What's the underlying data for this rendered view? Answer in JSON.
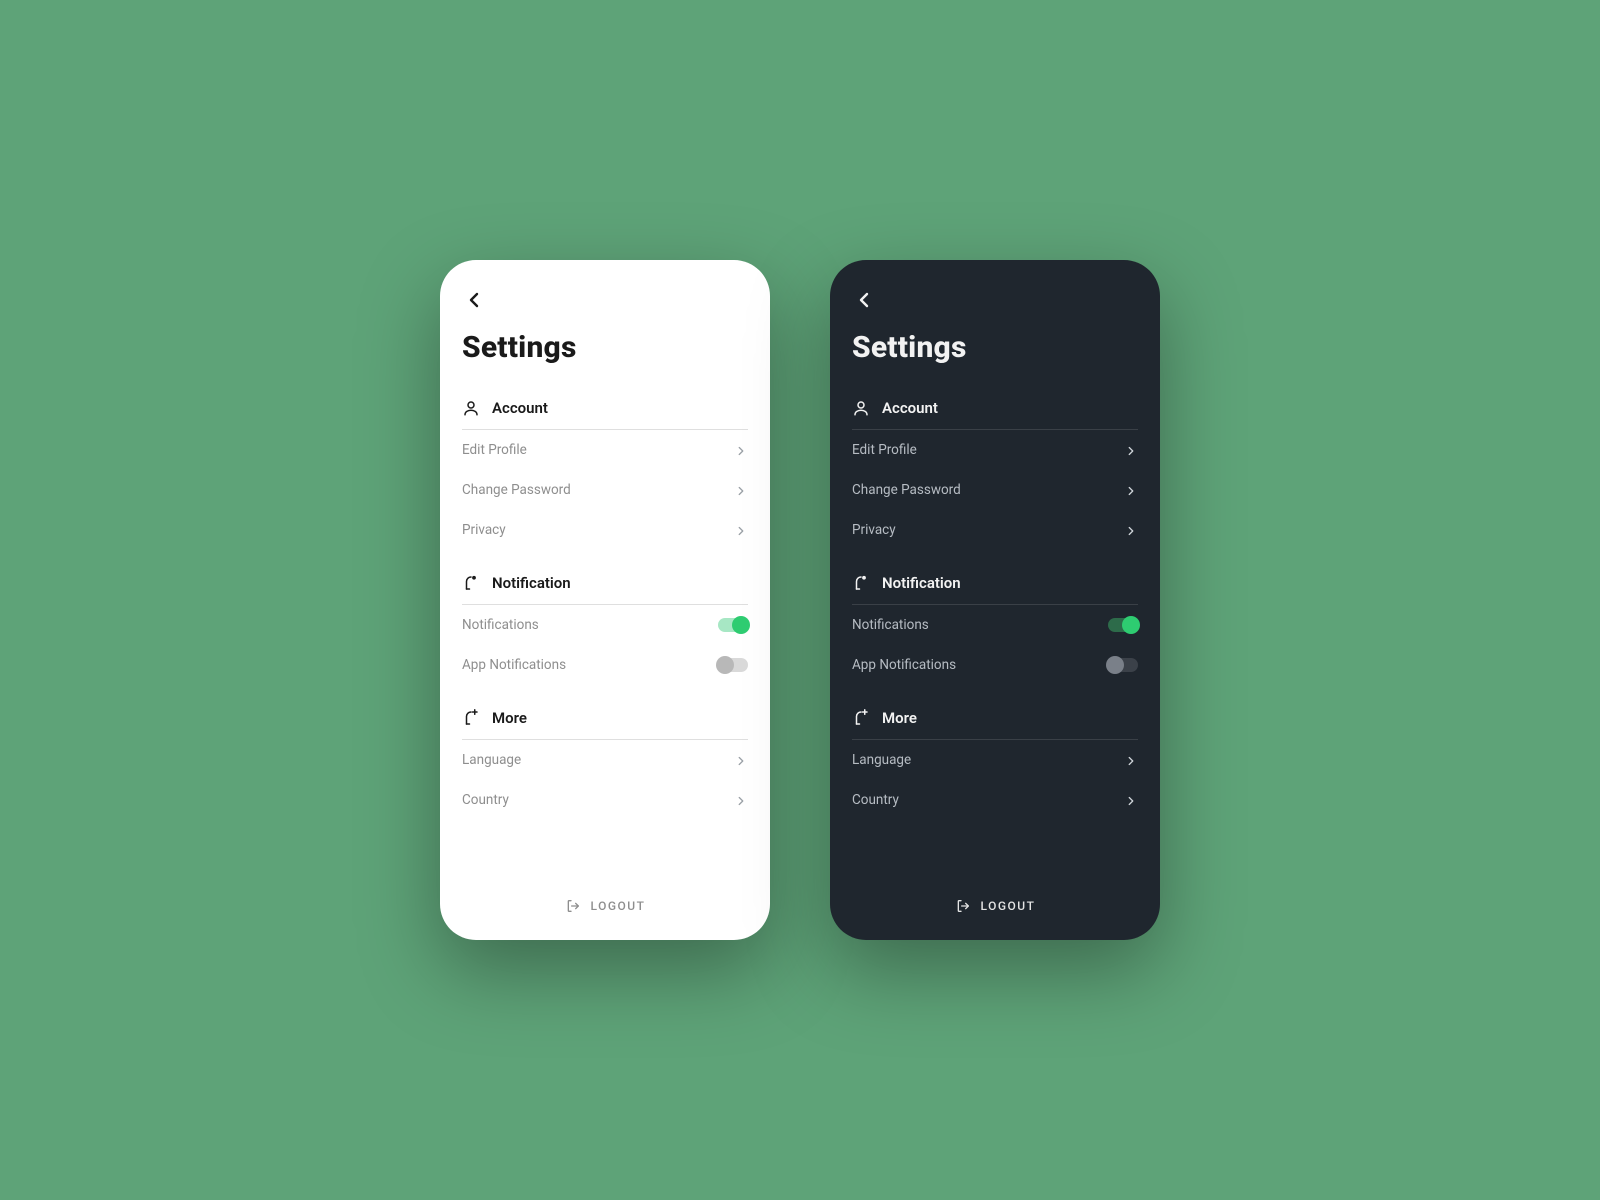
{
  "colors": {
    "background": "#5ea378",
    "light_bg": "#ffffff",
    "dark_bg": "#1f262e",
    "accent": "#2ecc71"
  },
  "page_title": "Settings",
  "sections": {
    "account": {
      "title": "Account",
      "items": [
        {
          "label": "Edit Profile"
        },
        {
          "label": "Change Password"
        },
        {
          "label": "Privacy"
        }
      ]
    },
    "notification": {
      "title": "Notification",
      "items": [
        {
          "label": "Notifications",
          "toggle": true
        },
        {
          "label": "App Notifications",
          "toggle": false
        }
      ]
    },
    "more": {
      "title": "More",
      "items": [
        {
          "label": "Language"
        },
        {
          "label": "Country"
        }
      ]
    }
  },
  "logout_label": "LOGOUT"
}
